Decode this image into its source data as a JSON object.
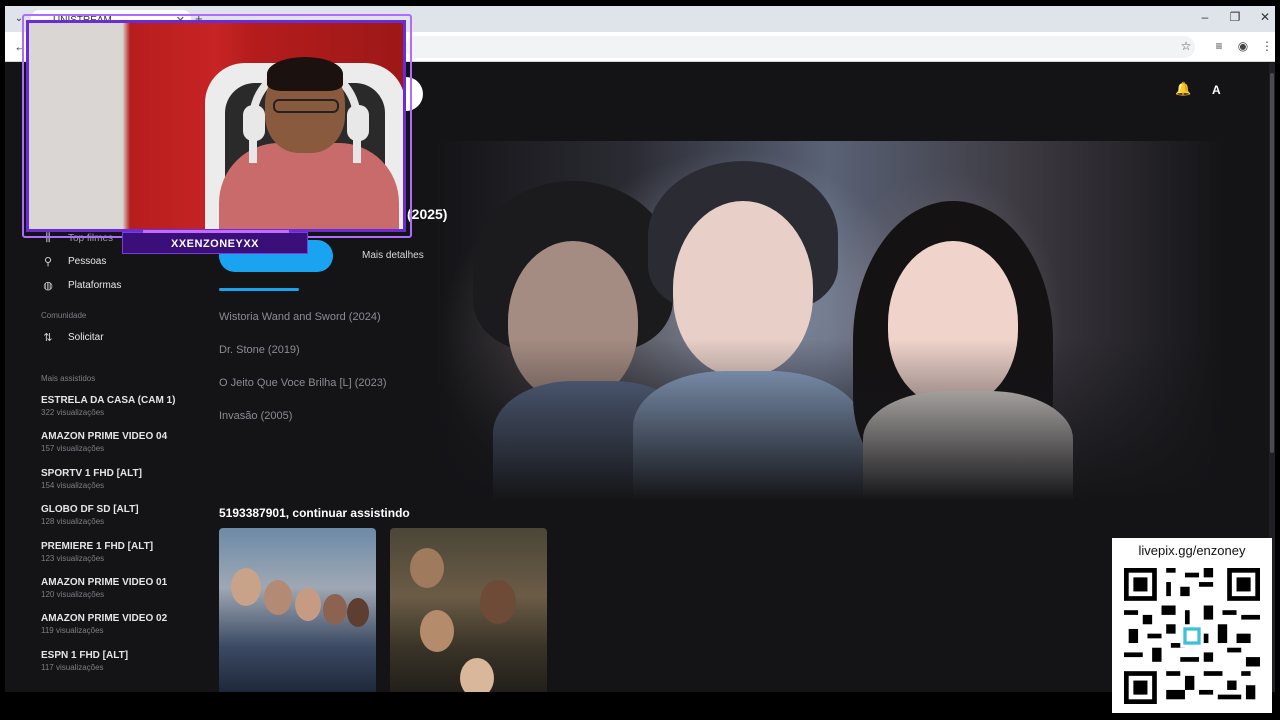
{
  "browser": {
    "tab_title": "UNISTREAM",
    "tab_close": "✕",
    "new_tab": "+",
    "menu_glyph": "⌄",
    "window_controls": {
      "minimize": "–",
      "restore": "❐",
      "close": "✕"
    },
    "back_glyph": "←"
  },
  "header": {
    "avatar_initial": "A",
    "bell_icon": "bell-icon"
  },
  "sidebar": {
    "top_item_partial": "Top filmes",
    "links": [
      {
        "icon": "person-icon",
        "glyph": "👤",
        "label": "Pessoas"
      },
      {
        "icon": "globe-icon",
        "glyph": "🌐",
        "label": "Plataformas"
      }
    ],
    "community_heading": "Comunidade",
    "community_links": [
      {
        "icon": "swap-icon",
        "glyph": "⇅",
        "label": "Solicitar"
      }
    ],
    "most_watched_heading": "Mais assistidos",
    "most_watched": [
      {
        "title": "ESTRELA DA CASA (CAM 1)",
        "views": "322 visualizações"
      },
      {
        "title": "AMAZON PRIME VIDEO 04",
        "views": "157 visualizações"
      },
      {
        "title": "SPORTV 1 FHD [ALT]",
        "views": "154 visualizações"
      },
      {
        "title": "GLOBO DF SD [ALT]",
        "views": "128 visualizações"
      },
      {
        "title": "PREMIERE 1 FHD [ALT]",
        "views": "123 visualizações"
      },
      {
        "title": "AMAZON PRIME VIDEO 01",
        "views": "120 visualizações"
      },
      {
        "title": "AMAZON PRIME VIDEO 02",
        "views": "119 visualizações"
      },
      {
        "title": "ESPN 1 FHD [ALT]",
        "views": "117 visualizações"
      }
    ]
  },
  "hero": {
    "year_suffix": "(2025)",
    "more_details": "Mais detalhes",
    "other_titles": [
      "Wistoria Wand and Sword (2024)",
      "Dr. Stone (2019)",
      "O Jeito Que Voce Brilha [L] (2023)",
      "Invasão (2005)"
    ]
  },
  "continue_watching": {
    "title": "5193387901, continuar assistindo"
  },
  "overlay": {
    "streamer_name": "XXENZONEYXX",
    "livepix": "livepix.gg/enzoney"
  },
  "colors": {
    "accent": "#1aa3f0",
    "background": "#141417",
    "overlay_purple": "#6b2bd6"
  }
}
